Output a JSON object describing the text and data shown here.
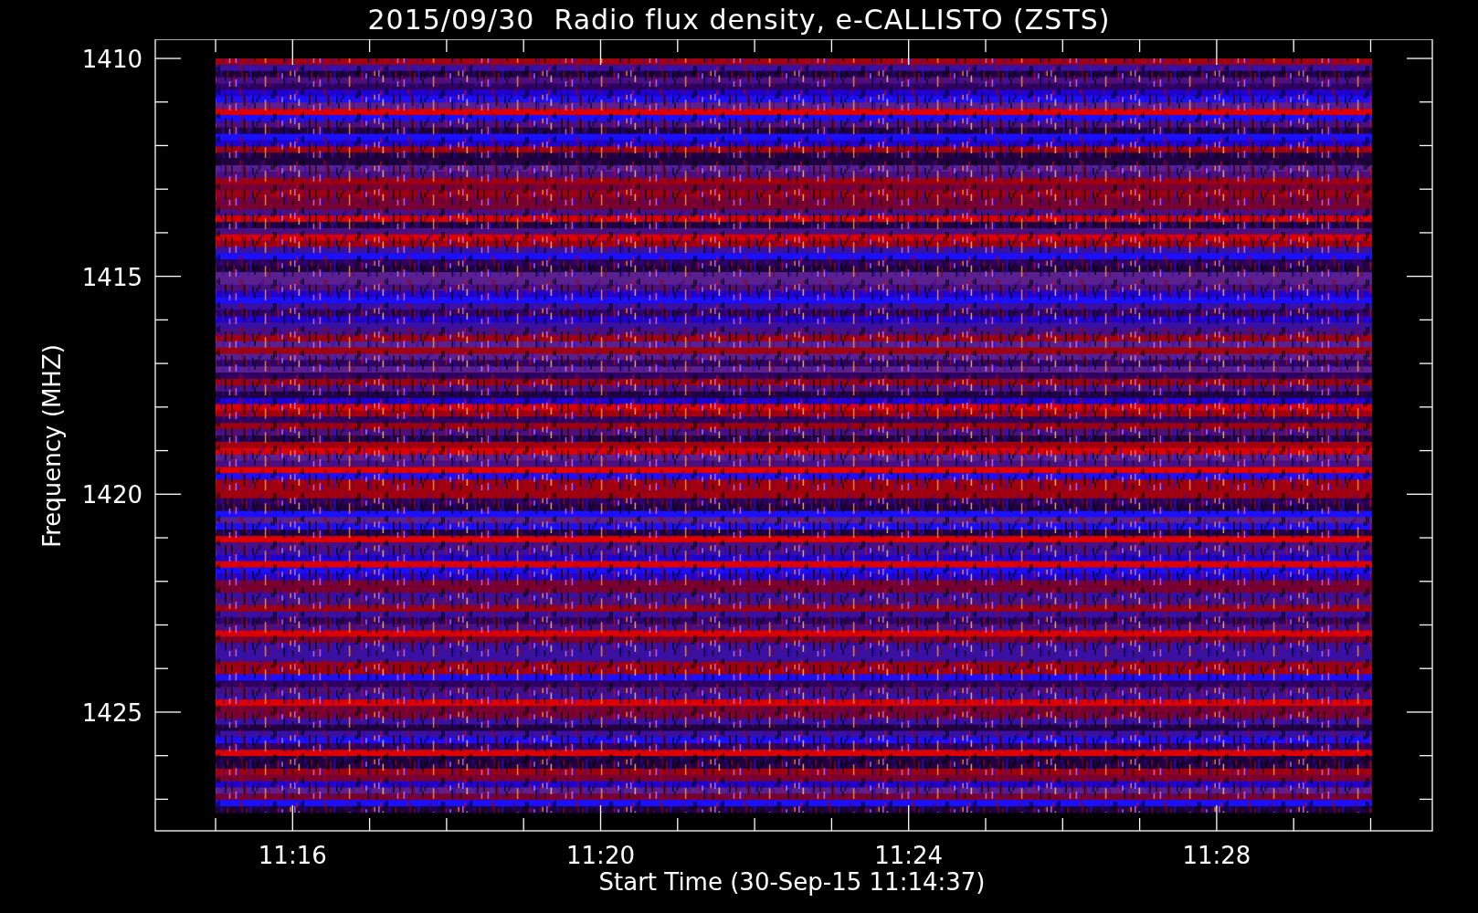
{
  "title": "2015/09/30  Radio flux density, e-CALLISTO (ZSTS)",
  "y_axis": {
    "label": "Frequency (MHZ)",
    "ticks": [
      "1410",
      "1415",
      "1420",
      "1425"
    ]
  },
  "x_axis": {
    "label": "Start Time (30-Sep-15 11:14:37)",
    "ticks": [
      "11:16",
      "11:20",
      "11:24",
      "11:28"
    ]
  }
}
